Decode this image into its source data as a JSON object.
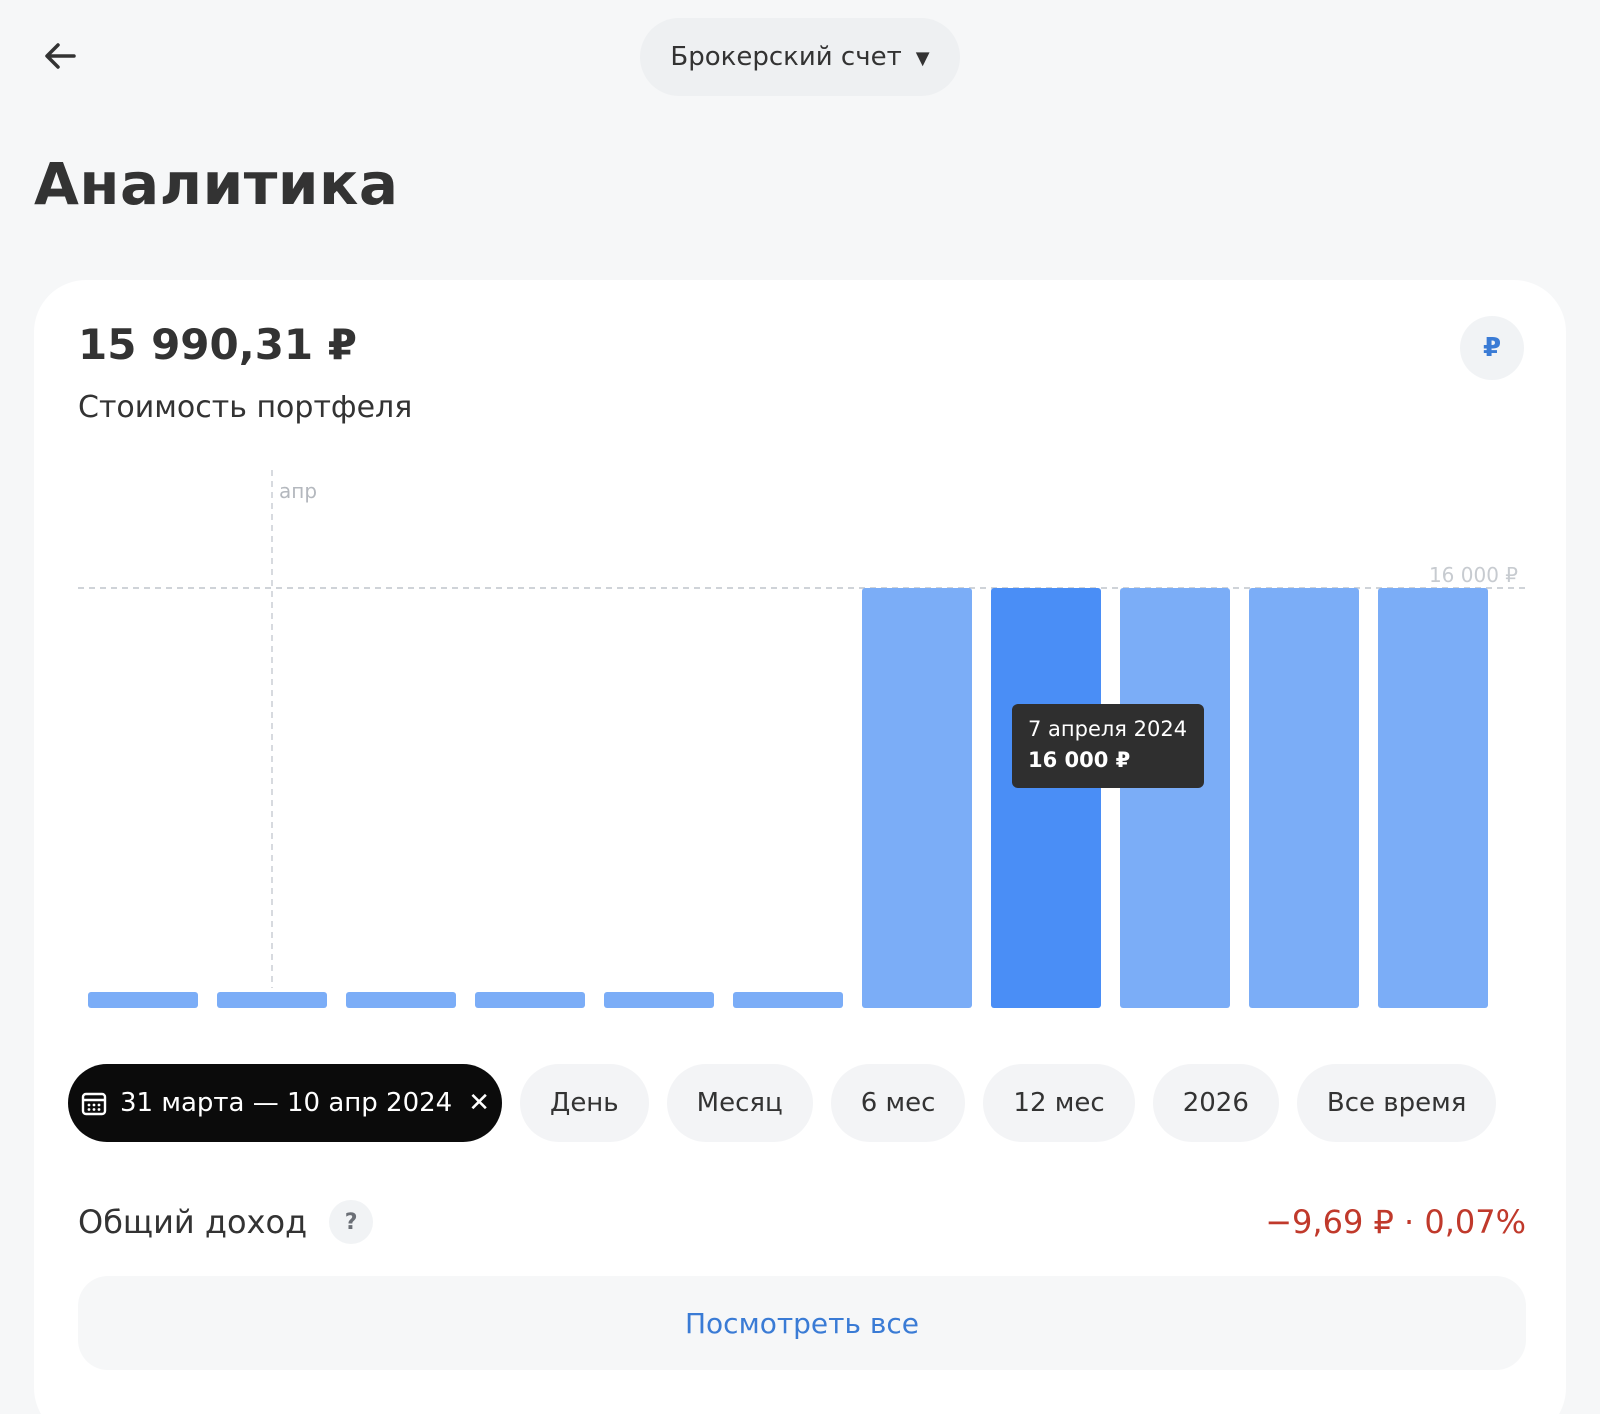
{
  "header": {
    "account_label": "Брокерский счет"
  },
  "page": {
    "title": "Аналитика"
  },
  "portfolio": {
    "value": "15 990,31 ₽",
    "label": "Стоимость портфеля",
    "currency_symbol": "₽"
  },
  "chart_data": {
    "type": "bar",
    "x_marker_label": "апр",
    "reference_label": "16 000 ₽",
    "reference_value": 16000,
    "ylim": [
      0,
      16000
    ],
    "values": [
      0,
      0,
      0,
      0,
      0,
      0,
      16000,
      16000,
      16000,
      16000,
      16000
    ],
    "selected_index": 7,
    "marker_index": 1,
    "colors": {
      "bar": "#7badf7",
      "bar_selected": "#4a8ef6",
      "grid": "#cfd3d8"
    }
  },
  "tooltip": {
    "date": "7 апреля 2024",
    "value": "16 000 ₽"
  },
  "periods": {
    "active_range": "31 марта — 10 апр 2024",
    "options": [
      "День",
      "Месяц",
      "6 мес",
      "12 мес",
      "2026",
      "Все время"
    ]
  },
  "income": {
    "label": "Общий доход",
    "value": "−9,69 ₽ · 0,07%"
  },
  "actions": {
    "see_all": "Посмотреть все"
  }
}
